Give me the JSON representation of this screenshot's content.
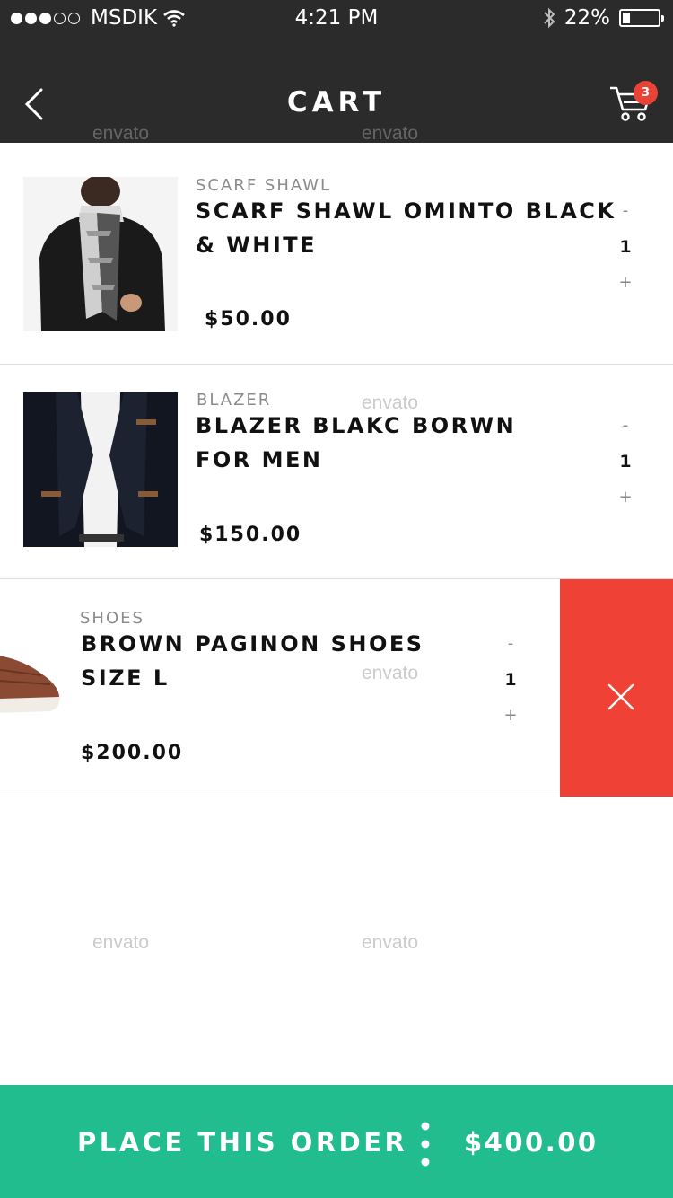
{
  "status_bar": {
    "carrier": "MSDIK",
    "time": "4:21 PM",
    "battery_percent": "22%",
    "battery_level": 0.22,
    "icons": [
      "signal-dots",
      "wifi-icon",
      "bluetooth-icon",
      "battery-icon"
    ]
  },
  "header": {
    "title": "CART",
    "back_icon": "chevron-left-icon",
    "cart_icon": "shopping-cart-icon",
    "cart_badge": "3"
  },
  "items": [
    {
      "category": "SCARF SHAWL",
      "name": "SCARF SHAWL OMINTO BLACK & WHITE",
      "price": "$50.00",
      "minus": "-",
      "quantity": "1",
      "plus": "+"
    },
    {
      "category": "BLAZER",
      "name": "BLAZER BLAKC BORWN FOR MEN",
      "price": "$150.00",
      "minus": "-",
      "quantity": "1",
      "plus": "+"
    },
    {
      "category": "SHOES",
      "name": "BROWN PAGINON SHOES SIZE L",
      "price": "$200.00",
      "minus": "-",
      "quantity": "1",
      "plus": "+"
    }
  ],
  "delete_action": {
    "icon": "close-icon",
    "color": "#ef4135"
  },
  "order_bar": {
    "label": "PLACE THIS ORDER",
    "total": "$400.00",
    "separator_icon": "vertical-dots-icon",
    "color": "#21bd8e"
  },
  "watermark": "envato",
  "colors": {
    "header_bg": "#2b2b2b",
    "badge": "#e94338"
  }
}
